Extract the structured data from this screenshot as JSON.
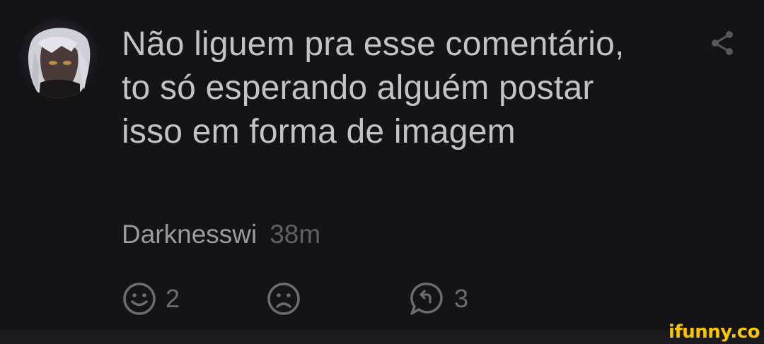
{
  "comment": {
    "text": "Não liguem pra esse comentário, to só esperando alguém postar isso em forma de imagem",
    "username": "Darknesswi",
    "timestamp": "38m"
  },
  "actions": {
    "like": {
      "icon": "smile-icon",
      "count": "2"
    },
    "dislike": {
      "icon": "frown-icon"
    },
    "reply": {
      "icon": "reply-bubble-icon",
      "count": "3"
    }
  },
  "share": {
    "icon": "share-icon"
  },
  "watermark": {
    "text": "ifunny.co"
  },
  "colors": {
    "background": "#141417",
    "text": "#c2c2c7",
    "username": "#9a9aa0",
    "muted": "#5f5f66",
    "watermark": "#f7c600"
  }
}
